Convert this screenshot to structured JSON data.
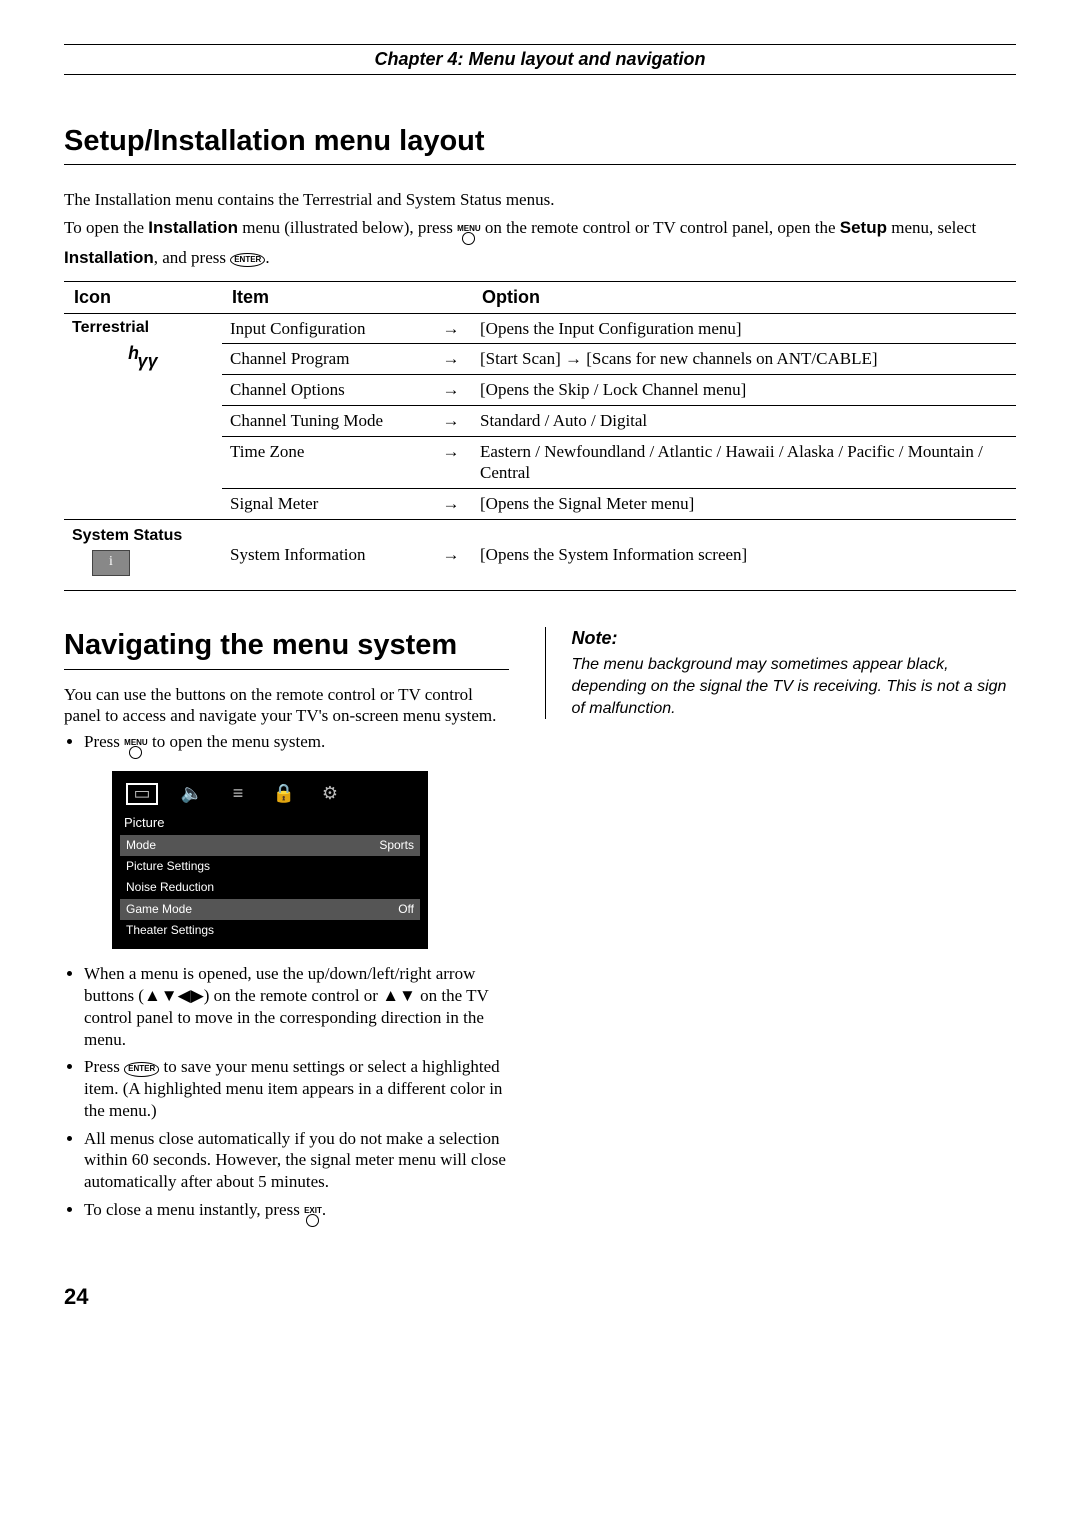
{
  "header": {
    "chapter": "Chapter 4: Menu layout and navigation"
  },
  "section1": {
    "title": "Setup/Installation menu layout",
    "intro1": "The Installation menu contains the Terrestrial and System Status menus.",
    "intro2_a": "To open the ",
    "intro2_b": "Installation",
    "intro2_c": " menu (illustrated below), press ",
    "intro2_d": " on the remote control or TV control panel, open the ",
    "intro2_e": "Setup",
    "intro2_f": " menu, select ",
    "intro2_g": "Installation",
    "intro2_h": ", and press ",
    "enter_label": "ENTER",
    "menu_label": "MENU",
    "exit_label": "EXIT",
    "table": {
      "head": {
        "icon": "Icon",
        "item": "Item",
        "option": "Option"
      },
      "terrestrial_label": "Terrestrial",
      "system_status_label": "System Status",
      "rows_terrestrial": [
        {
          "item": "Input Configuration",
          "option": "[Opens the Input Configuration menu]"
        },
        {
          "item": "Channel Program",
          "option": "[Start Scan] → [Scans for new channels on ANT/CABLE]"
        },
        {
          "item": "Channel Options",
          "option": "[Opens the Skip / Lock Channel menu]"
        },
        {
          "item": "Channel Tuning Mode",
          "option": "Standard / Auto / Digital"
        },
        {
          "item": "Time Zone",
          "option": "Eastern / Newfoundland / Atlantic / Hawaii / Alaska / Pacific / Mountain / Central"
        },
        {
          "item": "Signal Meter",
          "option": "[Opens the Signal Meter menu]"
        }
      ],
      "rows_system": [
        {
          "item": "System Information",
          "option": "[Opens the System Information screen]"
        }
      ]
    }
  },
  "section2": {
    "title": "Navigating the menu system",
    "para1": "You can use the buttons on the remote control or TV control panel to access and navigate your TV's on-screen menu system.",
    "bullets": [
      "Press  to open the menu system.",
      "When a menu is opened, use the up/down/left/right arrow buttons (▲▼◀▶) on the remote control or ▲▼ on the TV control panel to move in the corresponding direction in the menu.",
      "Press  to save your menu settings or select a highlighted item. (A highlighted menu item appears in a different color in the menu.)",
      "All menus close automatically if you do not make a selection within 60 seconds. However, the signal meter menu will close automatically after about 5 minutes.",
      "To close a menu instantly, press ."
    ],
    "osd": {
      "title": "Picture",
      "rows": [
        {
          "label": "Mode",
          "value": "Sports",
          "hi": true
        },
        {
          "label": "Picture Settings",
          "value": "",
          "hi": false
        },
        {
          "label": "Noise Reduction",
          "value": "",
          "hi": false
        },
        {
          "label": "Game Mode",
          "value": "Off",
          "hi": true
        },
        {
          "label": "Theater Settings",
          "value": "",
          "hi": false
        }
      ]
    }
  },
  "note": {
    "head": "Note:",
    "body": "The menu background may sometimes appear black, depending on the signal the TV is receiving. This is not a sign of malfunction."
  },
  "page_number": "24"
}
